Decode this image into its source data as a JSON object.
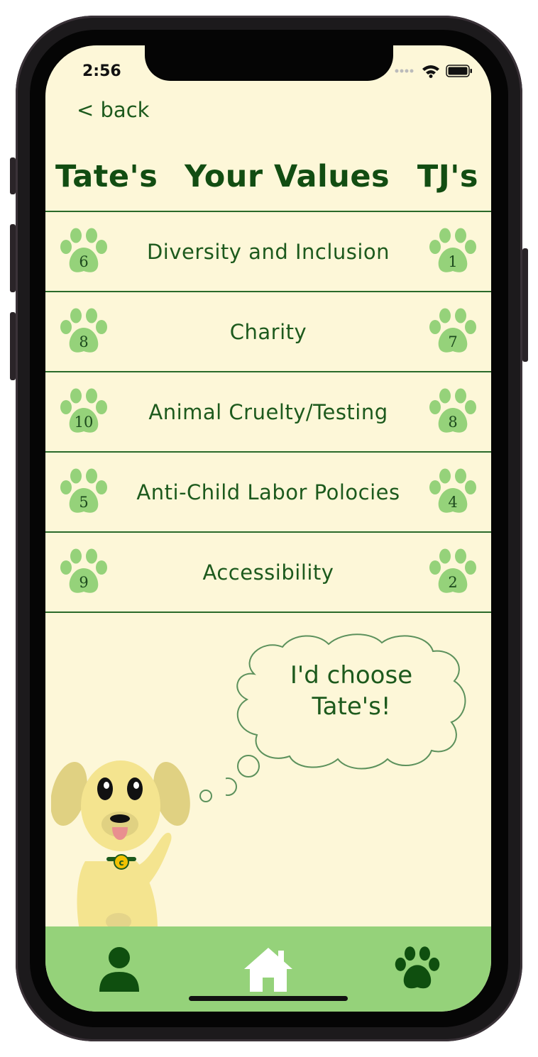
{
  "status_bar": {
    "time": "2:56",
    "icons": [
      "signal-dots-icon",
      "wifi-icon",
      "battery-icon"
    ]
  },
  "nav": {
    "back_label": "< back"
  },
  "header": {
    "left": "Tate's",
    "center": "Your Values",
    "right": "TJ's"
  },
  "values": [
    {
      "label": "Diversity and Inclusion",
      "left_score": "6",
      "right_score": "1"
    },
    {
      "label": "Charity",
      "left_score": "8",
      "right_score": "7"
    },
    {
      "label": "Animal Cruelty/Testing",
      "left_score": "10",
      "right_score": "8"
    },
    {
      "label": "Anti-Child Labor Polocies",
      "left_score": "5",
      "right_score": "4"
    },
    {
      "label": "Accessibility",
      "left_score": "9",
      "right_score": "2"
    }
  ],
  "thought_bubble": {
    "line1": "I'd choose",
    "line2": "Tate's!"
  },
  "tab_bar": {
    "tabs": [
      "person-icon",
      "home-icon",
      "paw-icon"
    ],
    "active_color": "#0f4f0f",
    "home_color": "#ffffff",
    "background": "#95d27a"
  },
  "colors": {
    "screen_bg": "#fdf7d8",
    "text": "#1d5a1d",
    "paw": "#95d27a"
  }
}
